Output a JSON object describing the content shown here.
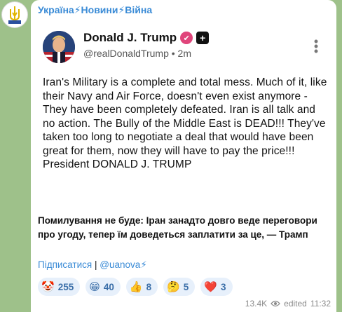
{
  "channel": {
    "title": "Україна⚡Новини⚡Війна"
  },
  "tweet": {
    "display_name": "Donald J. Trump",
    "handle": "@realDonaldTrump",
    "time": "2m",
    "text": "Iran's Military is a complete and total mess. Much of it, like their Navy and Air Force, doesn't even exist anymore - They have been completely defeated. Iran is all talk and no action. The Bully of the Middle East is DEAD!!! They've taken too long to negotiate a deal that would have been great for them, now they will have to pay the price!!! President DONALD J. TRUMP"
  },
  "caption": "Помилування не буде: Іран занадто довго веде переговори про угоду, тепер їм доведеться заплатити за це, — Трамп",
  "links": {
    "subscribe": "Підписатися",
    "separator": "|",
    "channel_link": "@uanova⚡"
  },
  "reactions": [
    {
      "emoji": "🤡",
      "count": "255"
    },
    {
      "emoji": "😁",
      "count": "40"
    },
    {
      "emoji": "👍",
      "count": "8"
    },
    {
      "emoji": "🤔",
      "count": "5"
    },
    {
      "emoji": "❤️",
      "count": "3"
    }
  ],
  "meta": {
    "views": "13.4K",
    "status": "edited",
    "time": "11:32"
  },
  "colors": {
    "background": "#9ec18a",
    "link": "#3a8bd6",
    "reaction_bg": "#e7f0fb",
    "verified_badge": "#e0457b"
  }
}
